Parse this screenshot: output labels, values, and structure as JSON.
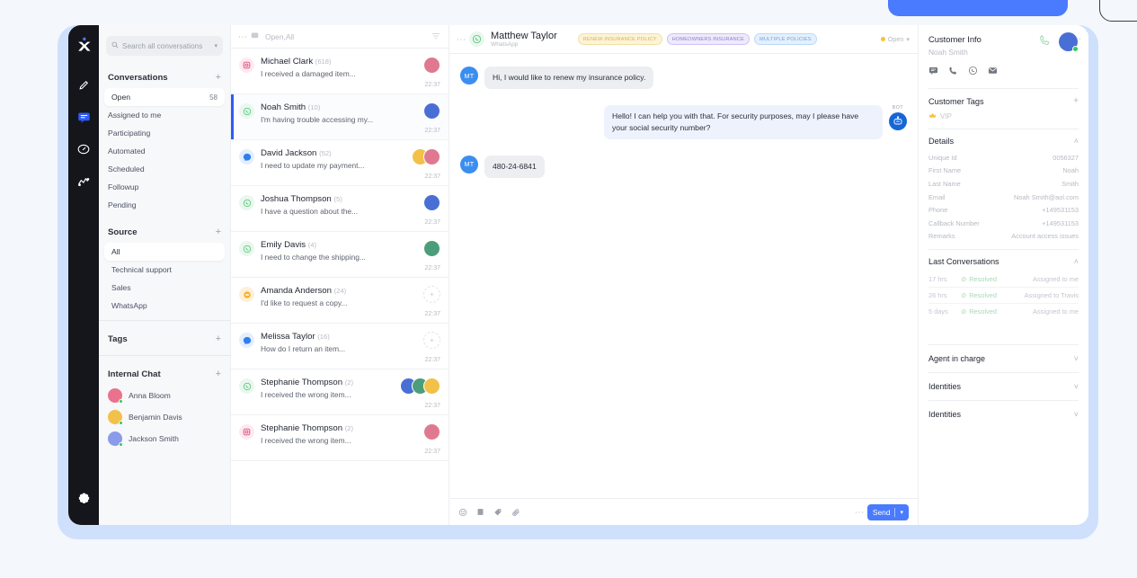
{
  "rail": {
    "logo": "x-logo-icon",
    "items": [
      {
        "name": "compose-icon",
        "label": "Compose"
      },
      {
        "name": "conversations-icon",
        "label": "Conversations",
        "active": true
      },
      {
        "name": "dashboard-icon",
        "label": "Dashboard"
      },
      {
        "name": "analytics-icon",
        "label": "Analytics"
      }
    ],
    "settings_label": "Settings"
  },
  "search": {
    "placeholder": "Search all conversations"
  },
  "sidebar": {
    "conversations_header": "Conversations",
    "plus": "+",
    "folders": [
      {
        "label": "Open",
        "count": "58",
        "selected": true
      },
      {
        "label": "Assigned to me",
        "count": ""
      },
      {
        "label": "Participating",
        "count": ""
      },
      {
        "label": "Automated",
        "count": ""
      },
      {
        "label": "Scheduled",
        "count": ""
      },
      {
        "label": "Followup",
        "count": ""
      },
      {
        "label": "Pending",
        "count": ""
      }
    ],
    "source_header": "Source",
    "sources": [
      {
        "label": "All",
        "selected": true
      },
      {
        "label": "Technical support"
      },
      {
        "label": "Sales"
      },
      {
        "label": "WhatsApp"
      }
    ],
    "tags_header": "Tags",
    "internal_chat_header": "Internal Chat",
    "internal_users": [
      {
        "name": "Anna Bloom",
        "color": "#e9738d",
        "online": true
      },
      {
        "name": "Benjamin Davis",
        "color": "#f2c14a",
        "online": true
      },
      {
        "name": "Jackson Smith",
        "color": "#8a9bea",
        "online": true
      }
    ]
  },
  "convlist": {
    "filter_label": "Open,All",
    "items": [
      {
        "name": "Michael Clark",
        "num": "(618)",
        "preview": "I received a damaged item...",
        "time": "22:37",
        "channel": "instagram",
        "avatars": [
          "#e0798f"
        ]
      },
      {
        "name": "Noah Smith",
        "num": "(10)",
        "preview": "I'm having trouble accessing my...",
        "time": "22:37",
        "channel": "whatsapp",
        "avatars": [
          "#4a6fd4"
        ],
        "active": true
      },
      {
        "name": "David Jackson",
        "num": "(52)",
        "preview": "I need to update my payment...",
        "time": "22:37",
        "channel": "messenger",
        "avatars": [
          "#f2c14a",
          "#e0798f"
        ]
      },
      {
        "name": "Joshua Thompson",
        "num": "(5)",
        "preview": "I have a question about the...",
        "time": "22:37",
        "channel": "whatsapp",
        "avatars": [
          "#4a6fd4"
        ]
      },
      {
        "name": "Emily Davis",
        "num": "(4)",
        "preview": "I need to change the shipping...",
        "time": "22:37",
        "channel": "whatsapp",
        "avatars": [
          "#4c9e7a"
        ]
      },
      {
        "name": "Amanda Anderson",
        "num": "(24)",
        "preview": "I'd like to request a copy...",
        "time": "22:37",
        "channel": "chat",
        "avatars": []
      },
      {
        "name": "Melissa Taylor",
        "num": "(16)",
        "preview": "How do I return an item...",
        "time": "22:37",
        "channel": "messenger",
        "avatars": []
      },
      {
        "name": "Stephanie Thompson",
        "num": "(2)",
        "preview": "I received the wrong item...",
        "time": "22:37",
        "channel": "whatsapp",
        "avatars": [
          "#4a6fd4",
          "#4c9e7a",
          "#f2c14a"
        ]
      },
      {
        "name": "Stephanie Thompson",
        "num": "(2)",
        "preview": "I received the wrong item...",
        "time": "22:37",
        "channel": "instagram",
        "avatars": [
          "#e0798f"
        ]
      }
    ]
  },
  "chat": {
    "contact_name": "Matthew Taylor",
    "channel": "WhatsApp",
    "tags": [
      {
        "label": "RENEW INSURANCE POLICY",
        "style": "t1"
      },
      {
        "label": "HOMEOWNERS INSURANCE",
        "style": "t2"
      },
      {
        "label": "MULTIPLE POLICIES",
        "style": "t3"
      }
    ],
    "status": "Open",
    "messages": [
      {
        "dir": "in",
        "avatar": "MT",
        "text": "Hi, I would like to renew my insurance policy."
      },
      {
        "dir": "out",
        "sender": "BOT",
        "text": "Hello! I can help you with that. For security purposes, may I please have your social security number?"
      },
      {
        "dir": "in",
        "avatar": "MT",
        "text": "480-24-6841"
      }
    ],
    "composer": {
      "icons": [
        "emoji-icon",
        "canned-response-icon",
        "tag-icon",
        "attachment-icon"
      ],
      "send_label": "Send"
    }
  },
  "rightbar": {
    "title": "Customer Info",
    "customer_name": "Noah Smith",
    "action_icons": [
      "chat-icon",
      "phone-icon",
      "whatsapp-icon",
      "email-icon"
    ],
    "tags_header": "Customer Tags",
    "tags": [
      {
        "label": "VIP",
        "icon": "crown-icon"
      }
    ],
    "details_header": "Details",
    "details": [
      {
        "k": "Unique Id",
        "v": "0056327"
      },
      {
        "k": "First Name",
        "v": "Noah"
      },
      {
        "k": "Last Name",
        "v": "Smith"
      },
      {
        "k": "Email",
        "v": "Noah Smith@aol.com"
      },
      {
        "k": "Phone",
        "v": "+149531153"
      },
      {
        "k": "Callback Number",
        "v": "+149531153"
      },
      {
        "k": "Remarks",
        "v": "Account access issues"
      }
    ],
    "last_conv_header": "Last Conversations",
    "last_conversations": [
      {
        "when": "17 hrs",
        "status": "Resolved",
        "assignee": "Assigned to me"
      },
      {
        "when": "26 hrs",
        "status": "Resolved",
        "assignee": "Assigned to Travis"
      },
      {
        "when": "5 days",
        "status": "Resolved",
        "assignee": "Assigned to me"
      }
    ],
    "collapsed": [
      {
        "label": "Agent in charge"
      },
      {
        "label": "Identities"
      },
      {
        "label": "Identities"
      }
    ]
  },
  "colors": {
    "accent": "#4a7afd",
    "rail_bg": "#15161c",
    "frame": "#cfe0fd",
    "page_bg": "#f4f7fc",
    "whatsapp": "#25d366",
    "instagram": "#e1306c",
    "messenger": "#2f80ed",
    "resolved": "#5cc77f"
  }
}
